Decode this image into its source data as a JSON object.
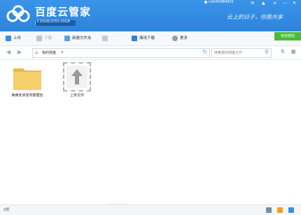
{
  "header": {
    "app_title": "百度云管家",
    "quota_text": "3.00GB/2055.00GB",
    "quota_fraction": 0.0015,
    "username": "ruth65984001",
    "slogan": "云上的日子，你我共享"
  },
  "toolbar": {
    "upload": "上传",
    "download": "下载",
    "new_folder": "新建文件夹",
    "offline_download": "离线下载",
    "more": "更多",
    "special_button": "特权帮助"
  },
  "nav": {
    "path": "我的网盘",
    "search_placeholder": "搜索我的网盘文件"
  },
  "items": [
    {
      "label": "西西安卓发布数据包"
    },
    {
      "label": "上传文件"
    }
  ],
  "status": {
    "count_text": "2项"
  },
  "watermark": "三联网 3LIAN.COM",
  "colors": {
    "header_blue": "#2c84dc",
    "folder_yellow": "#f5cf6a",
    "accent_green": "#4cba3a"
  }
}
